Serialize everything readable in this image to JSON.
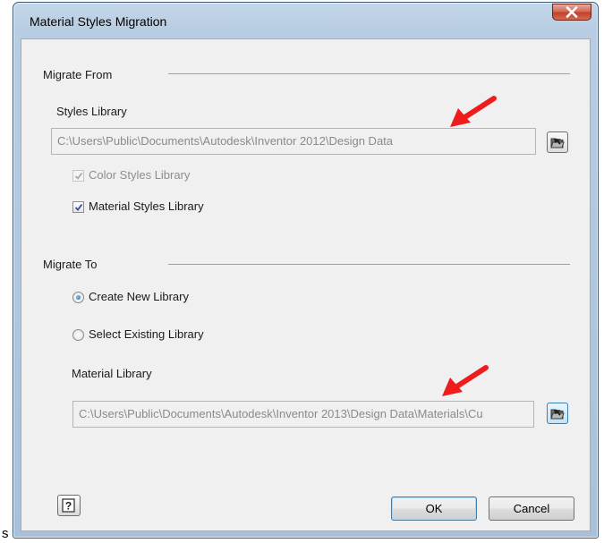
{
  "window": {
    "title": "Material Styles Migration"
  },
  "migrate_from": {
    "section_label": "Migrate From",
    "styles_library_label": "Styles Library",
    "styles_library_path": "C:\\Users\\Public\\Documents\\Autodesk\\Inventor 2012\\Design Data",
    "color_styles_label": "Color Styles Library",
    "color_styles_checked": true,
    "color_styles_enabled": false,
    "material_styles_label": "Material Styles Library",
    "material_styles_checked": true
  },
  "migrate_to": {
    "section_label": "Migrate To",
    "create_new_label": "Create New Library",
    "select_existing_label": "Select Existing Library",
    "selected_option": "Create New Library",
    "material_library_label": "Material Library",
    "material_library_path": "C:\\Users\\Public\\Documents\\Autodesk\\Inventor 2013\\Design Data\\Materials\\Cu"
  },
  "buttons": {
    "ok_label": "OK",
    "cancel_label": "Cancel"
  },
  "outside_text": "s",
  "colors": {
    "annotation_arrow": "#ee1c1c",
    "close_button": "#c9452f",
    "radio_dot": "#1b6bb4"
  },
  "icons": [
    "close-icon",
    "browse-folder-icon",
    "checkmark-icon",
    "help-icon",
    "annotation-arrow"
  ]
}
